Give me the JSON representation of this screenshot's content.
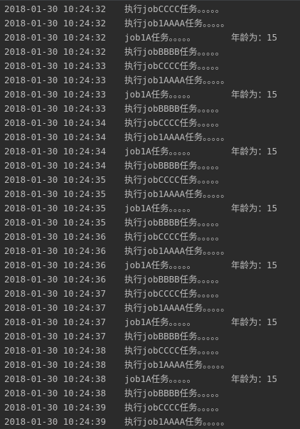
{
  "console": {
    "lines": [
      {
        "ts": "2018-01-30 10:24:32",
        "msg": "执行jobCCCC任务。。。。。",
        "age": ""
      },
      {
        "ts": "2018-01-30 10:24:32",
        "msg": "执行job1AAAA任务。。。。。",
        "age": ""
      },
      {
        "ts": "2018-01-30 10:24:32",
        "msg": "job1A任务。。。。。",
        "age": "年龄为：15"
      },
      {
        "ts": "2018-01-30 10:24:32",
        "msg": "执行jobBBBB任务。。。。。",
        "age": ""
      },
      {
        "ts": "2018-01-30 10:24:33",
        "msg": "执行jobCCCC任务。。。。。",
        "age": ""
      },
      {
        "ts": "2018-01-30 10:24:33",
        "msg": "执行job1AAAA任务。。。。。",
        "age": ""
      },
      {
        "ts": "2018-01-30 10:24:33",
        "msg": "job1A任务。。。。。",
        "age": "年龄为：15"
      },
      {
        "ts": "2018-01-30 10:24:33",
        "msg": "执行jobBBBB任务。。。。。",
        "age": ""
      },
      {
        "ts": "2018-01-30 10:24:34",
        "msg": "执行jobCCCC任务。。。。。",
        "age": ""
      },
      {
        "ts": "2018-01-30 10:24:34",
        "msg": "执行job1AAAA任务。。。。。",
        "age": ""
      },
      {
        "ts": "2018-01-30 10:24:34",
        "msg": "job1A任务。。。。。",
        "age": "年龄为：15"
      },
      {
        "ts": "2018-01-30 10:24:34",
        "msg": "执行jobBBBB任务。。。。。",
        "age": ""
      },
      {
        "ts": "2018-01-30 10:24:35",
        "msg": "执行jobCCCC任务。。。。。",
        "age": ""
      },
      {
        "ts": "2018-01-30 10:24:35",
        "msg": "执行job1AAAA任务。。。。。",
        "age": ""
      },
      {
        "ts": "2018-01-30 10:24:35",
        "msg": "job1A任务。。。。。",
        "age": "年龄为：15"
      },
      {
        "ts": "2018-01-30 10:24:35",
        "msg": "执行jobBBBB任务。。。。。",
        "age": ""
      },
      {
        "ts": "2018-01-30 10:24:36",
        "msg": "执行jobCCCC任务。。。。。",
        "age": ""
      },
      {
        "ts": "2018-01-30 10:24:36",
        "msg": "执行job1AAAA任务。。。。。",
        "age": ""
      },
      {
        "ts": "2018-01-30 10:24:36",
        "msg": "job1A任务。。。。。",
        "age": "年龄为：15"
      },
      {
        "ts": "2018-01-30 10:24:36",
        "msg": "执行jobBBBB任务。。。。。",
        "age": ""
      },
      {
        "ts": "2018-01-30 10:24:37",
        "msg": "执行jobCCCC任务。。。。。",
        "age": ""
      },
      {
        "ts": "2018-01-30 10:24:37",
        "msg": "执行job1AAAA任务。。。。。",
        "age": ""
      },
      {
        "ts": "2018-01-30 10:24:37",
        "msg": "job1A任务。。。。。",
        "age": "年龄为：15"
      },
      {
        "ts": "2018-01-30 10:24:37",
        "msg": "执行jobBBBB任务。。。。。",
        "age": ""
      },
      {
        "ts": "2018-01-30 10:24:38",
        "msg": "执行jobCCCC任务。。。。。",
        "age": ""
      },
      {
        "ts": "2018-01-30 10:24:38",
        "msg": "执行job1AAAA任务。。。。。",
        "age": ""
      },
      {
        "ts": "2018-01-30 10:24:38",
        "msg": "job1A任务。。。。。",
        "age": "年龄为：15"
      },
      {
        "ts": "2018-01-30 10:24:38",
        "msg": "执行jobBBBB任务。。。。。",
        "age": ""
      },
      {
        "ts": "2018-01-30 10:24:39",
        "msg": "执行jobCCCC任务。。。。。",
        "age": ""
      },
      {
        "ts": "2018-01-30 10:24:39",
        "msg": "执行job1AAAA任务。。。。。",
        "age": ""
      }
    ]
  },
  "colors": {
    "background": "#2b2b2b",
    "text": "#bbbbbb"
  }
}
